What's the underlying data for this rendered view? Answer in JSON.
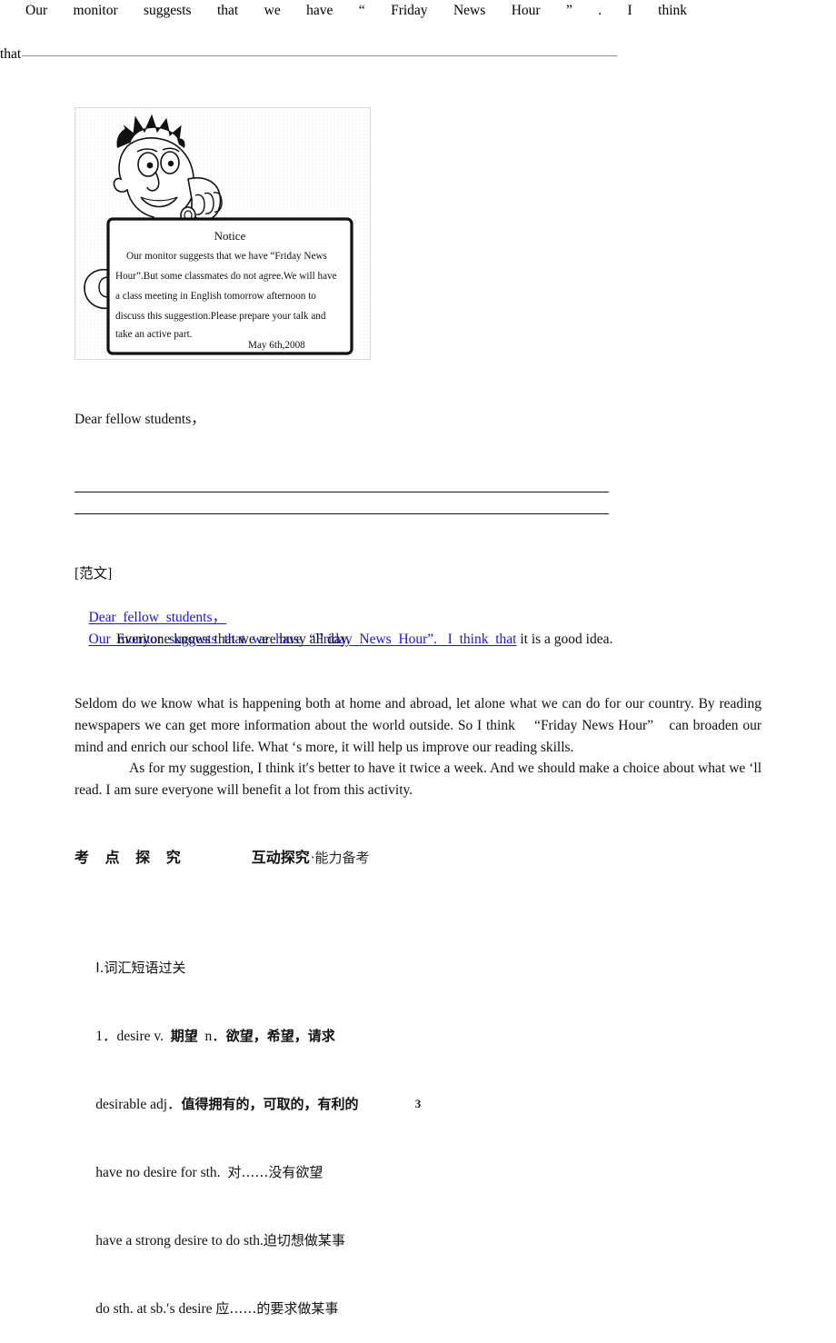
{
  "figure": {
    "alt_name": "notice-clipart",
    "notice_title": "Notice",
    "notice_lines": [
      "Our monitor suggests that we  have “Friday News",
      "Hour”.But some classmates do not agree.We will have",
      "a class meeting in English tomorrow afternoon to",
      "discuss this suggestion.Please prepare your talk and",
      "take an active part."
    ],
    "notice_date": "May 6th,2008"
  },
  "writing_task": {
    "salutation": "Dear fellow students，",
    "stretched_line": "Our  monitor  suggests  that  we  have  “  Friday  News  Hour  ”  .  I  think",
    "that_word": "that",
    "blank_line_count": 2
  },
  "model_answer": {
    "label": "[范文]",
    "line1_blue": "Dear  fellow  students，",
    "line2_blue": "Our  monitor  suggests  that  we  have  “Friday  News  Hour”.   I  think  that",
    "line2_black": " it is a good idea.",
    "line3": "Everyone knows that we are busy all day.",
    "blue_color": "#1a16d8"
  },
  "essay": {
    "paragraph1": "Seldom do we know what is happening both at home and abroad, let alone what we can do for our country. By reading newspapers we can get more information about the world outside. So I think 　“Friday News Hour”　can broaden our mind and enrich our school life. What ‘s more, it will help us improve our reading skills.",
    "paragraph2": "As for my suggestion, I think it′s better to have it twice a week. And we should make a choice about what we ‘ll read. I am sure everyone will benefit a lot from this activity."
  },
  "section_heading": {
    "main_title": "考 点 探 究",
    "sub_strong": "互动探究",
    "sub_light": "·能力备考"
  },
  "vocabulary": {
    "heading": "Ⅰ.词汇短语过关",
    "entries": [
      {
        "en": "1．desire v.  ",
        "cn_bold": "期望",
        "en2": "  n．",
        "cn_bold2": "欲望，希望，请求"
      },
      {
        "en": "desirable adj．",
        "cn_bold": "值得拥有的，可取的，有利的",
        "en2": "",
        "cn_bold2": ""
      },
      {
        "en": "have no desire for sth.  ",
        "cn_bold": "",
        "en2": "",
        "cn_bold2": "",
        "cn_plain": "对……没有欲望"
      },
      {
        "en": "have a strong desire to do sth.",
        "cn_bold": "",
        "en2": "",
        "cn_bold2": "",
        "cn_plain": "迫切想做某事"
      },
      {
        "en": "do sth. at sb.′s desire ",
        "cn_bold": "",
        "en2": "",
        "cn_bold2": "",
        "cn_plain": "应……的要求做某事"
      }
    ]
  },
  "footer": {
    "page_number": "3"
  }
}
